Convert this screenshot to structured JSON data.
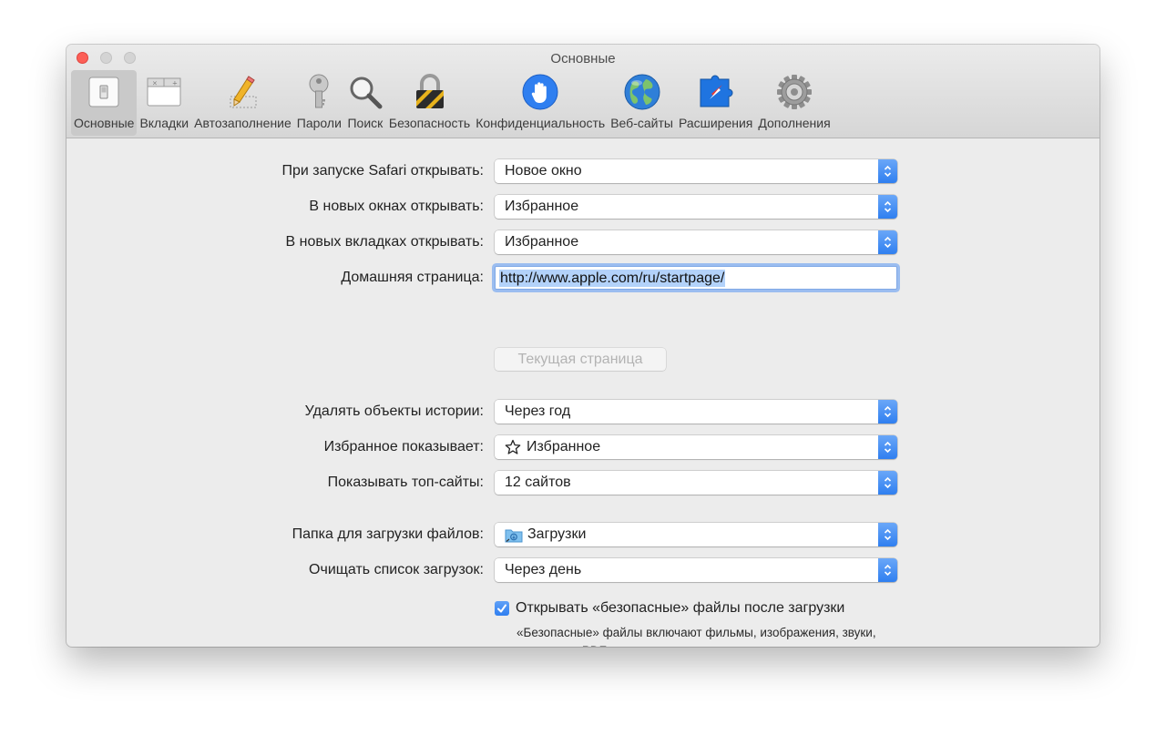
{
  "window": {
    "title": "Основные"
  },
  "toolbar": {
    "items": [
      {
        "label": "Основные",
        "icon": "general-switch-icon",
        "active": true
      },
      {
        "label": "Вкладки",
        "icon": "tabs-icon"
      },
      {
        "label": "Автозаполнение",
        "icon": "autofill-pencil-icon"
      },
      {
        "label": "Пароли",
        "icon": "key-icon"
      },
      {
        "label": "Поиск",
        "icon": "magnifier-icon"
      },
      {
        "label": "Безопасность",
        "icon": "padlock-icon"
      },
      {
        "label": "Конфиденциальность",
        "icon": "hand-icon"
      },
      {
        "label": "Веб-сайты",
        "icon": "globe-icon"
      },
      {
        "label": "Расширения",
        "icon": "extension-puzzle-icon"
      },
      {
        "label": "Дополнения",
        "icon": "gear-icon"
      }
    ]
  },
  "settings": {
    "safari_opens_with": {
      "label": "При запуске Safari открывать:",
      "value": "Новое окно"
    },
    "new_windows_open_with": {
      "label": "В новых окнах открывать:",
      "value": "Избранное"
    },
    "new_tabs_open_with": {
      "label": "В новых вкладках открывать:",
      "value": "Избранное"
    },
    "homepage": {
      "label": "Домашняя страница:",
      "value": "http://www.apple.com/ru/startpage/"
    },
    "set_current_page": {
      "label": "Текущая страница"
    },
    "remove_history": {
      "label": "Удалять объекты истории:",
      "value": "Через год"
    },
    "favorites_shows": {
      "label": "Избранное показывает:",
      "value": "Избранное",
      "icon": "star-icon"
    },
    "top_sites_shows": {
      "label": "Показывать топ-сайты:",
      "value": "12 сайтов"
    },
    "download_location": {
      "label": "Папка для загрузки файлов:",
      "value": "Загрузки",
      "icon": "downloads-folder-icon"
    },
    "remove_downloads": {
      "label": "Очищать список загрузок:",
      "value": "Через день"
    },
    "open_safe_files": {
      "label": "Открывать «безопасные» файлы после загрузки",
      "checked": true,
      "note": "«Безопасные» файлы включают фильмы, изображения, звуки, документы PDF и текстовые документы, а также архивы."
    },
    "help": {
      "label": "?"
    }
  },
  "colors": {
    "accent": "#2f7ff0",
    "close": "#fc5f57",
    "selection": "#b3d2fa"
  }
}
